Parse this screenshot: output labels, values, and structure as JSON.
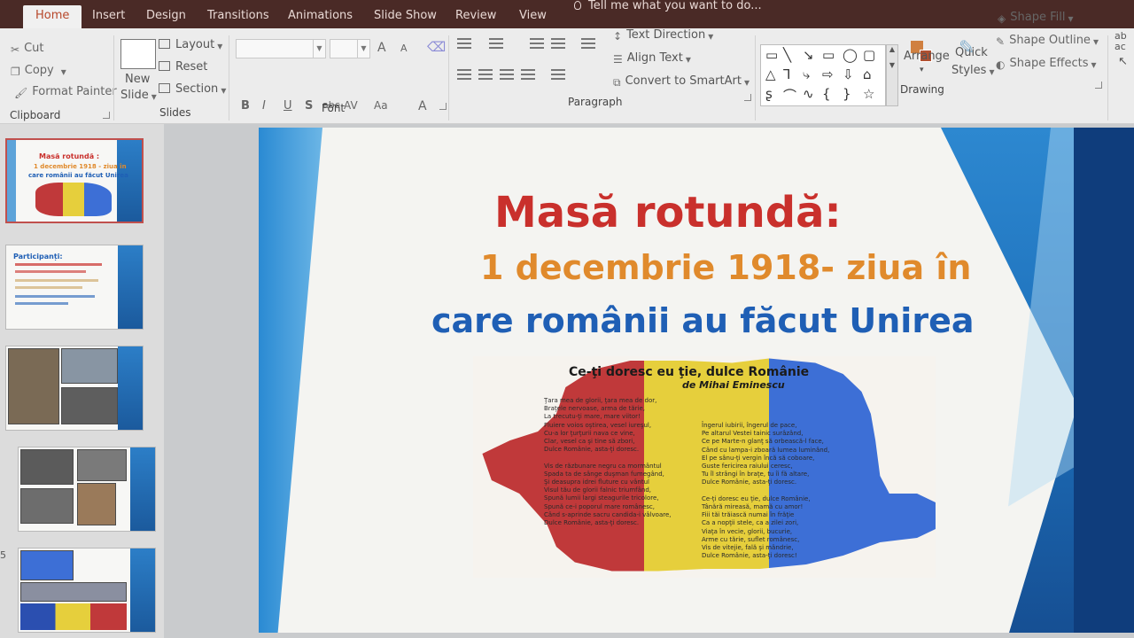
{
  "ribbon_tabs": [
    "Home",
    "Insert",
    "Design",
    "Transitions",
    "Animations",
    "Slide Show",
    "Review",
    "View"
  ],
  "tell_me": "Tell me what you want to do...",
  "clipboard": {
    "cut": "Cut",
    "copy": "Copy",
    "format_painter": "Format Painter",
    "label": "Clipboard"
  },
  "slides_group": {
    "new_slide_1": "New",
    "new_slide_2": "Slide",
    "layout": "Layout",
    "reset": "Reset",
    "section": "Section",
    "label": "Slides"
  },
  "font_group": {
    "bold": "B",
    "italic": "I",
    "underline": "U",
    "shadow": "S",
    "strike": "abc",
    "spacing": "AV",
    "case": "Aa",
    "color": "A",
    "grow": "A",
    "shrink": "A",
    "label": "Font"
  },
  "paragraph_group": {
    "text_direction": "Text Direction",
    "align_text": "Align Text",
    "convert_smartart": "Convert to SmartArt",
    "label": "Paragraph"
  },
  "drawing_group": {
    "arrange": "Arrange",
    "quick_styles_1": "Quick",
    "quick_styles_2": "Styles",
    "shape_fill": "Shape Fill",
    "shape_outline": "Shape Outline",
    "shape_effects": "Shape Effects",
    "label": "Drawing"
  },
  "right_edge": {
    "top": "ab",
    "bottom": "ac"
  },
  "thumbnails": {
    "numbers": [
      "5"
    ],
    "slide1_title": "Masă rotundă :",
    "slide1_sub1": "1 decembrie 1918 - ziua în",
    "slide1_sub2": "care românii au făcut Unirea",
    "slide2_heading": "Participanți:"
  },
  "slide": {
    "title": "Masă rotundă:",
    "subtitle_line1": "1 decembrie 1918- ziua în",
    "subtitle_line2": "care românii au făcut Unirea",
    "poem_title": "Ce-ţi doresc eu ţie, dulce Românie",
    "poem_author": "de Mihai Eminescu",
    "poem_col1": [
      "Ţara mea de glorii, ţara mea de dor,",
      "Braţele nervoase, arma de tărie,",
      "La trecutu-ţi mare, mare viitor!",
      "Fluiere voios oştirea, vesel iureşul,",
      "Cu-a lor ţurţurii nava ce vine,",
      "Clar, vesel ca şi tine să zbori,",
      "Dulce Românie, asta-ţi doresc.",
      "",
      "Vis de răzbunare negru ca mormântul",
      "Spada ta de sânge duşman fumegând,",
      "Şi deasupra idrei fluture cu vântul",
      "Visul tău de glorii falnic triumfând,",
      "Spună lumii largi steagurile tricolore,",
      "Spună ce-i poporul mare românesc,",
      "Când s-aprinde sacru candida-i vâlvoare,",
      "Dulce Românie, asta-ţi doresc."
    ],
    "poem_col2": [
      "Îngerul iubirii, îngerul de pace,",
      "Pe altarul Vestei tainic surâzând,",
      "Ce pe Marte-n glanţ să orbească-l face,",
      "Când cu lampa-i zboară lumea luminând,",
      "El pe sânu-ţi vergin încă să coboare,",
      "Guste fericirea raiului ceresc,",
      "Tu îl strângi în braţe, tu îi fă altare,",
      "Dulce Românie, asta-ţi doresc.",
      "",
      "Ce-ţi doresc eu ţie, dulce Românie,",
      "Tânără mireasă, mamă cu amor!",
      "Fiii tăi trăiască numai în frăţie",
      "Ca a nopţii stele, ca a zilei zori,",
      "Viaţa în vecie, glorii, bucurie,",
      "Arme cu tărie, suflet românesc,",
      "Vis de vitejie, fală şi mândrie,",
      "Dulce Românie, asta-ţi doresc!"
    ]
  },
  "colors": {
    "tabbar": "#4a2a26",
    "title_red": "#c9302c",
    "title_orange": "#e08a2c",
    "title_blue": "#1f5fb5"
  }
}
